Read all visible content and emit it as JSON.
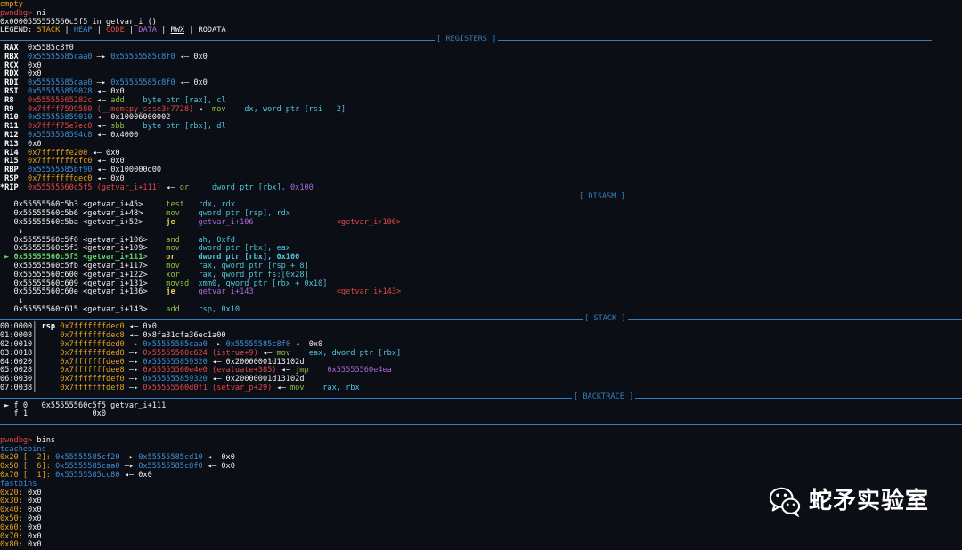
{
  "header": {
    "empty_text": "empty",
    "prompt": "pwndbg>",
    "cmd1": " ni",
    "location": "0x0000555555560c5f5 in getvar_i ()",
    "legend_prefix": "LEGEND: ",
    "legend_items": [
      "STACK",
      "HEAP",
      "CODE",
      "DATA",
      "RWX",
      "RODATA"
    ],
    "legend_sep": " | "
  },
  "sections": {
    "registers": "[ REGISTERS ]",
    "disasm": "[ DISASM ]",
    "stack": "[ STACK ]",
    "backtrace": "[ BACKTRACE ]"
  },
  "registers": [
    {
      "name": " RAX",
      "parts": [
        {
          "t": "  0x5585c8f0",
          "c": "white"
        }
      ]
    },
    {
      "name": " RBX",
      "parts": [
        {
          "t": "  0x55555585caa0",
          "c": "blue"
        },
        {
          "t": " —▸ ",
          "c": "white"
        },
        {
          "t": "0x55555585c8f0",
          "c": "blue"
        },
        {
          "t": " ◂— 0x0",
          "c": "white"
        }
      ]
    },
    {
      "name": " RCX",
      "parts": [
        {
          "t": "  0x0",
          "c": "white"
        }
      ]
    },
    {
      "name": " RDX",
      "parts": [
        {
          "t": "  0x0",
          "c": "white"
        }
      ]
    },
    {
      "name": " RDI",
      "parts": [
        {
          "t": "  0x55555585caa0",
          "c": "blue"
        },
        {
          "t": " —▸ ",
          "c": "white"
        },
        {
          "t": "0x55555585c8f0",
          "c": "blue"
        },
        {
          "t": " ◂— 0x0",
          "c": "white"
        }
      ]
    },
    {
      "name": " RSI",
      "parts": [
        {
          "t": "  0x555555859028",
          "c": "blue"
        },
        {
          "t": " ◂— 0x0",
          "c": "white"
        }
      ]
    },
    {
      "name": " R8 ",
      "parts": [
        {
          "t": "  0x55555565282c",
          "c": "red"
        },
        {
          "t": " ◂— ",
          "c": "white"
        },
        {
          "t": "add",
          "c": "green"
        },
        {
          "t": "    byte ptr [rax], cl",
          "c": "cyan"
        }
      ]
    },
    {
      "name": " R9 ",
      "parts": [
        {
          "t": "  0x7ffff7599580 (__memcpy_ssse3+7728)",
          "c": "red"
        },
        {
          "t": " ◂— ",
          "c": "white"
        },
        {
          "t": "mov",
          "c": "green"
        },
        {
          "t": "    dx, word ptr [rsi - 2]",
          "c": "cyan"
        }
      ]
    },
    {
      "name": " R10",
      "parts": [
        {
          "t": "  0x555555859010",
          "c": "blue"
        },
        {
          "t": " ◂— 0x10006000002",
          "c": "white"
        }
      ]
    },
    {
      "name": " R11",
      "parts": [
        {
          "t": "  0x7ffff75e7ec0",
          "c": "red"
        },
        {
          "t": " ◂— ",
          "c": "white"
        },
        {
          "t": "sbb",
          "c": "green"
        },
        {
          "t": "    byte ptr [rbx], dl",
          "c": "cyan"
        }
      ]
    },
    {
      "name": " R12",
      "parts": [
        {
          "t": "  0x5555558594c8",
          "c": "blue"
        },
        {
          "t": " ◂— 0x4000",
          "c": "white"
        }
      ]
    },
    {
      "name": " R13",
      "parts": [
        {
          "t": "  0x0",
          "c": "white"
        }
      ]
    },
    {
      "name": " R14",
      "parts": [
        {
          "t": "  0x7ffffffe200",
          "c": "orange"
        },
        {
          "t": " ◂— 0x0",
          "c": "white"
        }
      ]
    },
    {
      "name": " R15",
      "parts": [
        {
          "t": "  0x7fffffffdfc0",
          "c": "orange"
        },
        {
          "t": " ◂— 0x0",
          "c": "white"
        }
      ]
    },
    {
      "name": " RBP",
      "parts": [
        {
          "t": "  0x55555585bf90",
          "c": "blue"
        },
        {
          "t": " ◂— 0x100000d00",
          "c": "white"
        }
      ]
    },
    {
      "name": " RSP",
      "parts": [
        {
          "t": "  0x7fffffffdec0",
          "c": "orange"
        },
        {
          "t": " ◂— 0x0",
          "c": "white"
        }
      ]
    },
    {
      "name": "*RIP",
      "parts": [
        {
          "t": "  0x55555560c5f5 (getvar_i+111)",
          "c": "red"
        },
        {
          "t": " ◂— ",
          "c": "white"
        },
        {
          "t": "or",
          "c": "green"
        },
        {
          "t": "     dword ptr [rbx], ",
          "c": "cyan"
        },
        {
          "t": "0x100",
          "c": "purple"
        }
      ]
    }
  ],
  "disasm": [
    {
      "addr": "   0x55555560c5b3 <getvar_i+45> ",
      "mn": "    test",
      "ops": "   rdx, rdx",
      "target": "",
      "cur": false
    },
    {
      "addr": "   0x55555560c5b6 <getvar_i+48> ",
      "mn": "    mov ",
      "ops": "   qword ptr [rsp], rdx",
      "target": "",
      "cur": false
    },
    {
      "addr": "   0x55555560c5ba <getvar_i+52> ",
      "mn": "    je  ",
      "ops": "   getvar_i+106",
      "target": "                  <getvar_i+106>",
      "cur": false,
      "je": true
    },
    {
      "addr": "    ↓",
      "mn": "",
      "ops": "",
      "target": "",
      "cur": false,
      "arrow": true
    },
    {
      "addr": "   0x55555560c5f0 <getvar_i+106>",
      "mn": "    and ",
      "ops": "   ah, 0xfd",
      "target": "",
      "cur": false
    },
    {
      "addr": "   0x55555560c5f3 <getvar_i+109>",
      "mn": "    mov ",
      "ops": "   dword ptr [rbx], eax",
      "target": "",
      "cur": false
    },
    {
      "addr": " ► 0x55555560c5f5 <getvar_i+111>",
      "mn": "    or  ",
      "ops": "   dword ptr [rbx], 0x100",
      "target": "",
      "cur": true
    },
    {
      "addr": "   0x55555560c5fb <getvar_i+117>",
      "mn": "    mov ",
      "ops": "   rax, qword ptr [rsp + 8]",
      "target": "",
      "cur": false
    },
    {
      "addr": "   0x55555560c600 <getvar_i+122>",
      "mn": "    xor ",
      "ops": "   rax, qword ptr fs:[0x28]",
      "target": "",
      "cur": false
    },
    {
      "addr": "   0x55555560c609 <getvar_i+131>",
      "mn": "    movsd",
      "ops": "  xmm0, qword ptr [rbx + 0x10]",
      "target": "",
      "cur": false
    },
    {
      "addr": "   0x55555560c60e <getvar_i+136>",
      "mn": "    je  ",
      "ops": "   getvar_i+143",
      "target": "                  <getvar_i+143>",
      "cur": false,
      "je": true
    },
    {
      "addr": "    ↓",
      "mn": "",
      "ops": "",
      "target": "",
      "cur": false,
      "arrow": true
    },
    {
      "addr": "   0x55555560c615 <getvar_i+143>",
      "mn": "    add ",
      "ops": "   rsp, 0x10",
      "target": "",
      "cur": false
    }
  ],
  "stack": [
    {
      "idx": "00:0000│ ",
      "reg": "rsp ",
      "parts": [
        {
          "t": "0x7fffffffdec0",
          "c": "orange"
        },
        {
          "t": " ◂— 0x0",
          "c": "white"
        }
      ]
    },
    {
      "idx": "01:0008│ ",
      "reg": "    ",
      "parts": [
        {
          "t": "0x7fffffffdec8",
          "c": "orange"
        },
        {
          "t": " ◂— 0x8fa31cfa36ec1a00",
          "c": "white"
        }
      ]
    },
    {
      "idx": "02:0010│ ",
      "reg": "    ",
      "parts": [
        {
          "t": "0x7fffffffded0",
          "c": "orange"
        },
        {
          "t": " —▸ ",
          "c": "white"
        },
        {
          "t": "0x55555585caa0",
          "c": "blue"
        },
        {
          "t": " —▸ ",
          "c": "white"
        },
        {
          "t": "0x55555585c8f0",
          "c": "blue"
        },
        {
          "t": " ◂— 0x0",
          "c": "white"
        }
      ]
    },
    {
      "idx": "03:0018│ ",
      "reg": "    ",
      "parts": [
        {
          "t": "0x7fffffffded8",
          "c": "orange"
        },
        {
          "t": " —▸ ",
          "c": "white"
        },
        {
          "t": "0x55555560c624 (istrue+9)",
          "c": "red"
        },
        {
          "t": " ◂— ",
          "c": "white"
        },
        {
          "t": "mov",
          "c": "green"
        },
        {
          "t": "    eax, dword ptr [rbx]",
          "c": "cyan"
        }
      ]
    },
    {
      "idx": "04:0020│ ",
      "reg": "    ",
      "parts": [
        {
          "t": "0x7fffffffdee0",
          "c": "orange"
        },
        {
          "t": " —▸ ",
          "c": "white"
        },
        {
          "t": "0x555555859320",
          "c": "blue"
        },
        {
          "t": " ◂— 0x20000001d13102d",
          "c": "white"
        }
      ]
    },
    {
      "idx": "05:0028│ ",
      "reg": "    ",
      "parts": [
        {
          "t": "0x7fffffffdee8",
          "c": "orange"
        },
        {
          "t": " —▸ ",
          "c": "white"
        },
        {
          "t": "0x55555560e4e0 (evaluate+385)",
          "c": "red"
        },
        {
          "t": " ◂— ",
          "c": "white"
        },
        {
          "t": "jmp",
          "c": "green"
        },
        {
          "t": "    0x55555560e4ea",
          "c": "purple"
        }
      ]
    },
    {
      "idx": "06:0030│ ",
      "reg": "    ",
      "parts": [
        {
          "t": "0x7fffffffdef0",
          "c": "orange"
        },
        {
          "t": " —▸ ",
          "c": "white"
        },
        {
          "t": "0x555555859320",
          "c": "blue"
        },
        {
          "t": " ◂— 0x20000001d13102d",
          "c": "white"
        }
      ]
    },
    {
      "idx": "07:0038│ ",
      "reg": "    ",
      "parts": [
        {
          "t": "0x7fffffffdef8",
          "c": "orange"
        },
        {
          "t": " —▸ ",
          "c": "white"
        },
        {
          "t": "0x55555560d0f1 (setvar_p+29)",
          "c": "red"
        },
        {
          "t": " ◂— ",
          "c": "white"
        },
        {
          "t": "mov",
          "c": "green"
        },
        {
          "t": "    rax, rbx",
          "c": "cyan"
        }
      ]
    }
  ],
  "backtrace": [
    " ► f 0   0x55555560c5f5 getvar_i+111",
    "   f 1              0x0"
  ],
  "bins": {
    "prompt": "pwndbg>",
    "cmd": " bins",
    "tcache_title": "tcachebins",
    "tcache": [
      {
        "size": "0x20 [  2]: ",
        "parts": [
          {
            "t": "0x55555585cf20",
            "c": "blue"
          },
          {
            "t": " —▸ ",
            "c": "white"
          },
          {
            "t": "0x55555585cd10",
            "c": "blue"
          },
          {
            "t": " ◂— 0x0",
            "c": "white"
          }
        ]
      },
      {
        "size": "0x50 [  6]: ",
        "parts": [
          {
            "t": "0x55555585caa0",
            "c": "blue"
          },
          {
            "t": " —▸ ",
            "c": "white"
          },
          {
            "t": "0x55555585c8f0",
            "c": "blue"
          },
          {
            "t": " ◂— 0x0",
            "c": "white"
          }
        ]
      },
      {
        "size": "0x70 [  1]: ",
        "parts": [
          {
            "t": "0x55555585cc80",
            "c": "blue"
          },
          {
            "t": " ◂— 0x0",
            "c": "white"
          }
        ]
      }
    ],
    "fast_title": "fastbins",
    "fast": [
      {
        "size": "0x20: ",
        "val": "0x0"
      },
      {
        "size": "0x30: ",
        "val": "0x0"
      },
      {
        "size": "0x40: ",
        "val": "0x0"
      },
      {
        "size": "0x50: ",
        "val": "0x0"
      },
      {
        "size": "0x60: ",
        "val": "0x0"
      },
      {
        "size": "0x70: ",
        "val": "0x0"
      },
      {
        "size": "0x80: ",
        "val": "0x0"
      }
    ]
  },
  "watermark": {
    "text": "蛇矛实验室",
    "icon": "wechat-icon"
  },
  "colors": {
    "background": "#0c0e15",
    "separator": "#2f7fc2",
    "heap": "#3d8fd8",
    "stack": "#e8a11c",
    "code": "#e04848",
    "data": "#a96ad8",
    "prompt": "#e04848"
  }
}
